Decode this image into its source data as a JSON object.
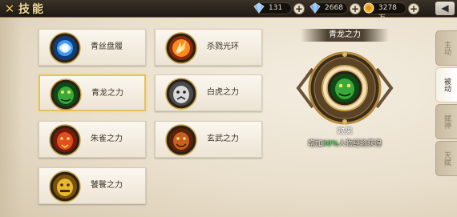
{
  "header": {
    "close_glyph": "✕",
    "title": "技能",
    "resources": [
      {
        "name": "diamond-icon",
        "value": "131",
        "color": "#6fb3ff"
      },
      {
        "name": "bound-diamond-icon",
        "value": "2668",
        "color": "#6fb3ff"
      },
      {
        "name": "gold-coin-icon",
        "value": "3278万",
        "color": "#f0b33a"
      }
    ],
    "plus_glyph": "+",
    "back_glyph": "◀"
  },
  "skills": [
    {
      "label": "青丝盘履",
      "icon": "qingsi-panlv-icon",
      "color": "#4fa8ff",
      "selected": false
    },
    {
      "label": "杀戮光环",
      "icon": "shalu-guanghuan-icon",
      "color": "#ff8a1e",
      "selected": false
    },
    {
      "label": "青龙之力",
      "icon": "qinglong-power-icon",
      "color": "#3aa83a",
      "selected": true
    },
    {
      "label": "白虎之力",
      "icon": "baihu-power-icon",
      "color": "#d9d9d9",
      "selected": false
    },
    {
      "label": "朱雀之力",
      "icon": "zhuque-power-icon",
      "color": "#e0501e",
      "selected": false
    },
    {
      "label": "玄武之力",
      "icon": "xuanwu-power-icon",
      "color": "#c8601e",
      "selected": false
    },
    {
      "label": "饕餮之力",
      "icon": "taotie-power-icon",
      "color": "#e8b830",
      "selected": false
    }
  ],
  "detail": {
    "title": "青龙之力",
    "effect_label": "效果",
    "desc_prefix": "增加",
    "desc_highlight": "30%",
    "desc_suffix": "人物经验获得",
    "icon": "qinglong-medal-icon"
  },
  "side_tabs": [
    {
      "label": "主动",
      "active": false
    },
    {
      "label": "被动",
      "active": true
    },
    {
      "label": "赋神",
      "active": false
    },
    {
      "label": "天赋",
      "active": false
    }
  ]
}
